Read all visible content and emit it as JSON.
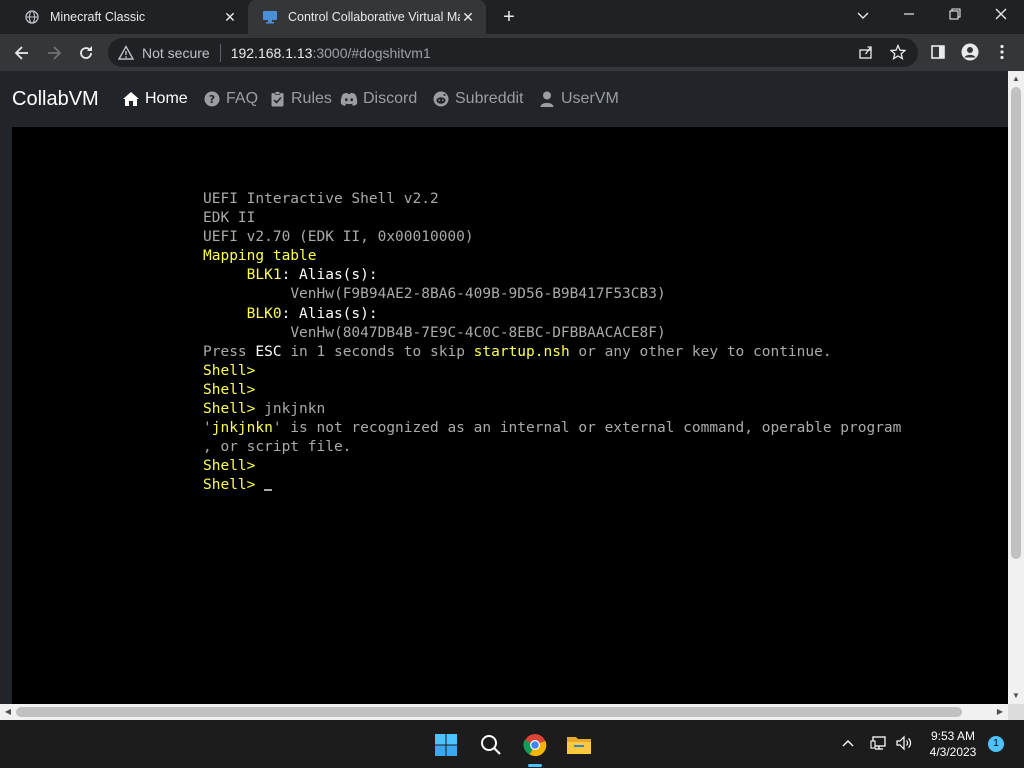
{
  "browser": {
    "tabs": [
      {
        "title": "Minecraft Classic",
        "icon": "globe-icon",
        "active": false
      },
      {
        "title": "Control Collaborative Virtual Mac",
        "icon": "monitor-icon",
        "active": true
      }
    ],
    "new_tab_label": "+",
    "address": {
      "security_label": "Not secure",
      "host": "192.168.1.13",
      "path": ":3000/#dogshitvm1"
    }
  },
  "site": {
    "brand": "CollabVM",
    "nav": [
      {
        "label": "Home",
        "icon": "home-icon",
        "active": true
      },
      {
        "label": "FAQ",
        "icon": "question-circle-icon",
        "active": false
      },
      {
        "label": "Rules",
        "icon": "clipboard-check-icon",
        "active": false
      },
      {
        "label": "Discord",
        "icon": "discord-icon",
        "active": false
      },
      {
        "label": "Subreddit",
        "icon": "reddit-icon",
        "active": false
      },
      {
        "label": "UserVM",
        "icon": "user-icon",
        "active": false
      }
    ]
  },
  "terminal": {
    "lines": {
      "l1": "UEFI Interactive Shell v2.2",
      "l2": "EDK II",
      "l3": "UEFI v2.70 (EDK II, 0x00010000)",
      "l4": "Mapping table",
      "l5_dev": "BLK1",
      "l5_rest": ": Alias(s):",
      "l6": "VenHw(F9B94AE2-8BA6-409B-9D56-B9B417F53CB3)",
      "l7_dev": "BLK0",
      "l7_rest": ": Alias(s):",
      "l8": "VenHw(8047DB4B-7E9C-4C0C-8EBC-DFBBAACACE8F)",
      "l9_a": "Press ",
      "l9_b": "ESC",
      "l9_c": " in 1 seconds to skip ",
      "l9_d": "startup.nsh",
      "l9_e": " or any other key to continue.",
      "prompt": "Shell>",
      "l12_cmd": " jnkjnkn",
      "l13_a": "'",
      "l13_b": "jnkjnkn",
      "l13_c": "' is not recognized as an internal or external command, operable program",
      "l14": ", or script file."
    }
  },
  "taskbar": {
    "apps": [
      "windows-start-icon",
      "search-icon",
      "chrome-icon",
      "file-explorer-icon"
    ],
    "time": "9:53 AM",
    "date": "4/3/2023",
    "notification_count": "1"
  },
  "colors": {
    "terminal_default": "#aaaaaa",
    "terminal_yellow": "#ffff55",
    "terminal_white": "#ffffff",
    "accent": "#4cc2ff"
  }
}
